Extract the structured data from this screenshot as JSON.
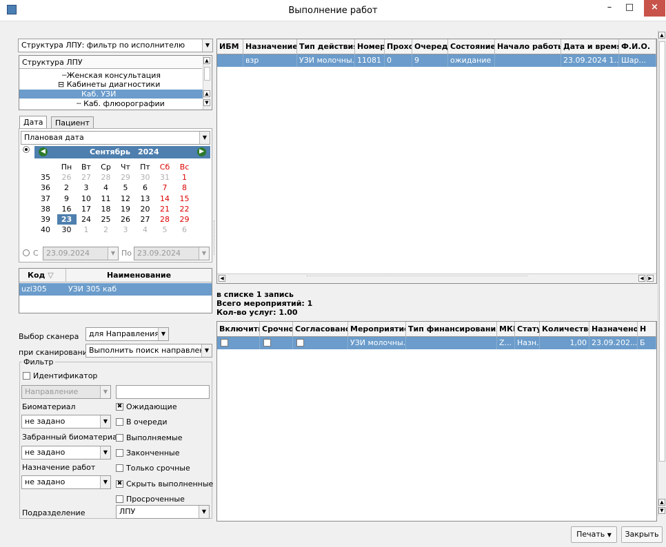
{
  "window": {
    "title": "Выполнение работ",
    "minimize": "–",
    "maximize": "□",
    "close": "×"
  },
  "left": {
    "structure_filter": "Структура ЛПУ: фильтр по исполнителю",
    "tree_header": "Структура ЛПУ",
    "tree_items": [
      "Женская консультация",
      "Кабинеты диагностики",
      "Каб. УЗИ",
      "Каб. флюорографии"
    ],
    "tabs": [
      "Дата",
      "Пациент"
    ],
    "date_type": "Плановая дата",
    "calendar": {
      "month": "Сентябрь",
      "year": "2024",
      "weekdays": [
        "Пн",
        "Вт",
        "Ср",
        "Чт",
        "Пт",
        "Сб",
        "Вс"
      ],
      "weeks": [
        {
          "wk": "35",
          "days": [
            "26",
            "27",
            "28",
            "29",
            "30",
            "31",
            "1"
          ]
        },
        {
          "wk": "36",
          "days": [
            "2",
            "3",
            "4",
            "5",
            "6",
            "7",
            "8"
          ]
        },
        {
          "wk": "37",
          "days": [
            "9",
            "10",
            "11",
            "12",
            "13",
            "14",
            "15"
          ]
        },
        {
          "wk": "38",
          "days": [
            "16",
            "17",
            "18",
            "19",
            "20",
            "21",
            "22"
          ]
        },
        {
          "wk": "39",
          "days": [
            "23",
            "24",
            "25",
            "26",
            "27",
            "28",
            "29"
          ]
        },
        {
          "wk": "40",
          "days": [
            "30",
            "1",
            "2",
            "3",
            "4",
            "5",
            "6"
          ]
        }
      ],
      "today": "23"
    },
    "range": {
      "from_label": "С",
      "from": "23.09.2024",
      "to_label": "По",
      "to": "23.09.2024"
    },
    "code_table": {
      "headers": [
        "Код",
        "Наименование"
      ],
      "rows": [
        {
          "code": "uzi305",
          "name": "УЗИ 305 каб"
        }
      ]
    },
    "scanner_label": "Выбор сканера",
    "scanner_value": "для Направления",
    "on_scan_label": "при сканировании",
    "on_scan_value": "Выполнить поиск направления",
    "filter": {
      "title": "Фильтр",
      "identifier": "Идентификатор",
      "direction": "Направление",
      "biomaterial_label": "Биоматериал",
      "biomaterial_value": "не задано",
      "taken_label": "Забранный биоматериал",
      "taken_value": "не задано",
      "work_label": "Назначение работ",
      "work_value": "не задано",
      "checks": [
        "Ожидающие",
        "В очереди",
        "Выполняемые",
        "Законченные",
        "Только срочные",
        "Скрыть выполненные",
        "Просроченные"
      ],
      "checked": [
        true,
        false,
        false,
        false,
        false,
        true,
        false
      ]
    },
    "subdivision_label": "Подразделение",
    "subdivision_value": "ЛПУ"
  },
  "top_grid": {
    "headers": [
      "ИБМ",
      "Назначение",
      "Тип действия",
      "Номер",
      "Проход",
      "Очередь",
      "Состояние",
      "Начало работы",
      "Дата и время",
      "Ф.И.О."
    ],
    "row": [
      "",
      "взр",
      "УЗИ молочны...",
      "11081",
      "0",
      "9",
      "ожидание",
      "",
      "23.09.2024 1...",
      "Шар..."
    ]
  },
  "summary": [
    "в списке 1 запись",
    "Всего мероприятий: 1",
    "Кол-во услуг: 1.00"
  ],
  "bottom_grid": {
    "headers": [
      "Включить",
      "Срочно",
      "Согласовано",
      "Мероприятие",
      "Тип финансирования",
      "МКБ",
      "Статус",
      "Количество",
      "Назначено",
      "Н"
    ],
    "row": [
      "",
      "",
      "",
      "УЗИ молочны...",
      "",
      "Z...",
      "Назн...",
      "1,00",
      "23.09.202...",
      "Б"
    ]
  },
  "buttons": {
    "print": "Печать",
    "close": "Закрыть"
  }
}
